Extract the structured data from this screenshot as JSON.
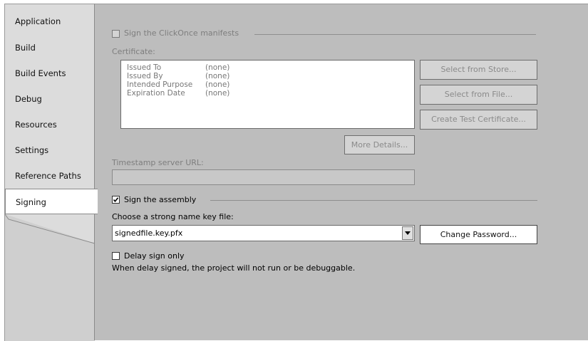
{
  "sidebar": {
    "items": [
      {
        "label": "Application"
      },
      {
        "label": "Build"
      },
      {
        "label": "Build Events"
      },
      {
        "label": "Debug"
      },
      {
        "label": "Resources"
      },
      {
        "label": "Settings"
      },
      {
        "label": "Reference Paths"
      },
      {
        "label": "Signing",
        "active": true
      }
    ]
  },
  "clickonce": {
    "checkbox_label": "Sign the ClickOnce manifests",
    "checked": false,
    "certificate_label": "Certificate:",
    "fields": [
      {
        "key": "Issued To",
        "value": "(none)"
      },
      {
        "key": "Issued By",
        "value": "(none)"
      },
      {
        "key": "Intended Purpose",
        "value": "(none)"
      },
      {
        "key": "Expiration Date",
        "value": "(none)"
      }
    ],
    "select_from_store": "Select from Store...",
    "select_from_file": "Select from File...",
    "create_test_certificate": "Create Test Certificate...",
    "more_details": "More Details...",
    "timestamp_label": "Timestamp server URL:",
    "timestamp_value": ""
  },
  "assembly": {
    "checkbox_label": "Sign the assembly",
    "checked": true,
    "key_file_label": "Choose a strong name key file:",
    "key_file_value": "signedfile.key.pfx",
    "change_password": "Change Password...",
    "delay_sign_label": "Delay sign only",
    "delay_sign_checked": false,
    "delay_note": "When delay signed, the project will not run or be debuggable."
  }
}
